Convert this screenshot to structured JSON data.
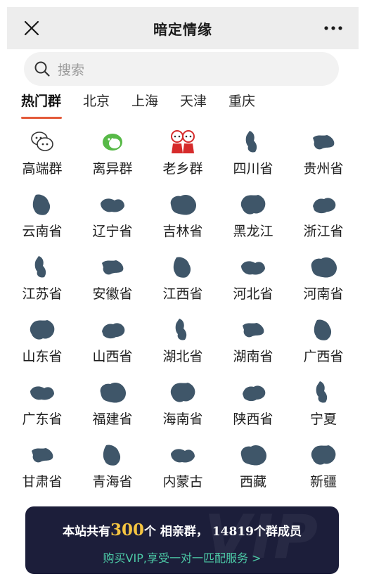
{
  "header": {
    "title": "暗定情缘"
  },
  "search": {
    "placeholder": "搜索"
  },
  "tabs": [
    {
      "label": "热门群",
      "active": true
    },
    {
      "label": "北京"
    },
    {
      "label": "上海"
    },
    {
      "label": "天津"
    },
    {
      "label": "重庆"
    }
  ],
  "grid": [
    {
      "label": "高端群",
      "icon": "chat-bubbles-icon"
    },
    {
      "label": "离异群",
      "icon": "green-chat-icon"
    },
    {
      "label": "老乡群",
      "icon": "red-couple-icon"
    },
    {
      "label": "四川省",
      "icon": "province-map-icon"
    },
    {
      "label": "贵州省",
      "icon": "province-map-icon"
    },
    {
      "label": "云南省",
      "icon": "province-map-icon"
    },
    {
      "label": "辽宁省",
      "icon": "province-map-icon"
    },
    {
      "label": "吉林省",
      "icon": "province-map-icon"
    },
    {
      "label": "黑龙江",
      "icon": "province-map-icon"
    },
    {
      "label": "浙江省",
      "icon": "province-map-icon"
    },
    {
      "label": "江苏省",
      "icon": "province-map-icon"
    },
    {
      "label": "安徽省",
      "icon": "province-map-icon"
    },
    {
      "label": "江西省",
      "icon": "province-map-icon"
    },
    {
      "label": "河北省",
      "icon": "province-map-icon"
    },
    {
      "label": "河南省",
      "icon": "province-map-icon"
    },
    {
      "label": "山东省",
      "icon": "province-map-icon"
    },
    {
      "label": "山西省",
      "icon": "province-map-icon"
    },
    {
      "label": "湖北省",
      "icon": "province-map-icon"
    },
    {
      "label": "湖南省",
      "icon": "province-map-icon"
    },
    {
      "label": "广西省",
      "icon": "province-map-icon"
    },
    {
      "label": "广东省",
      "icon": "province-map-icon"
    },
    {
      "label": "福建省",
      "icon": "province-map-icon"
    },
    {
      "label": "海南省",
      "icon": "province-map-icon"
    },
    {
      "label": "陕西省",
      "icon": "province-map-icon"
    },
    {
      "label": "宁夏",
      "icon": "province-map-icon"
    },
    {
      "label": "甘肃省",
      "icon": "province-map-icon"
    },
    {
      "label": "青海省",
      "icon": "province-map-icon"
    },
    {
      "label": "内蒙古",
      "icon": "province-map-icon"
    },
    {
      "label": "西藏",
      "icon": "province-map-icon"
    },
    {
      "label": "新疆",
      "icon": "province-map-icon"
    }
  ],
  "banner": {
    "line1_prefix": "本站共有",
    "group_count": "300",
    "line1_mid": "个 相亲群，",
    "member_count": "14819",
    "line1_suffix": "个群成员",
    "line2": "购买VIP,享受一对一匹配服务 >"
  },
  "colors": {
    "map_fill": "#3f5669",
    "accent_underline": "#e35a3a",
    "banner_bg": "#1c1e3a",
    "banner_number": "#f4c441",
    "banner_link": "#4cc9a6"
  }
}
